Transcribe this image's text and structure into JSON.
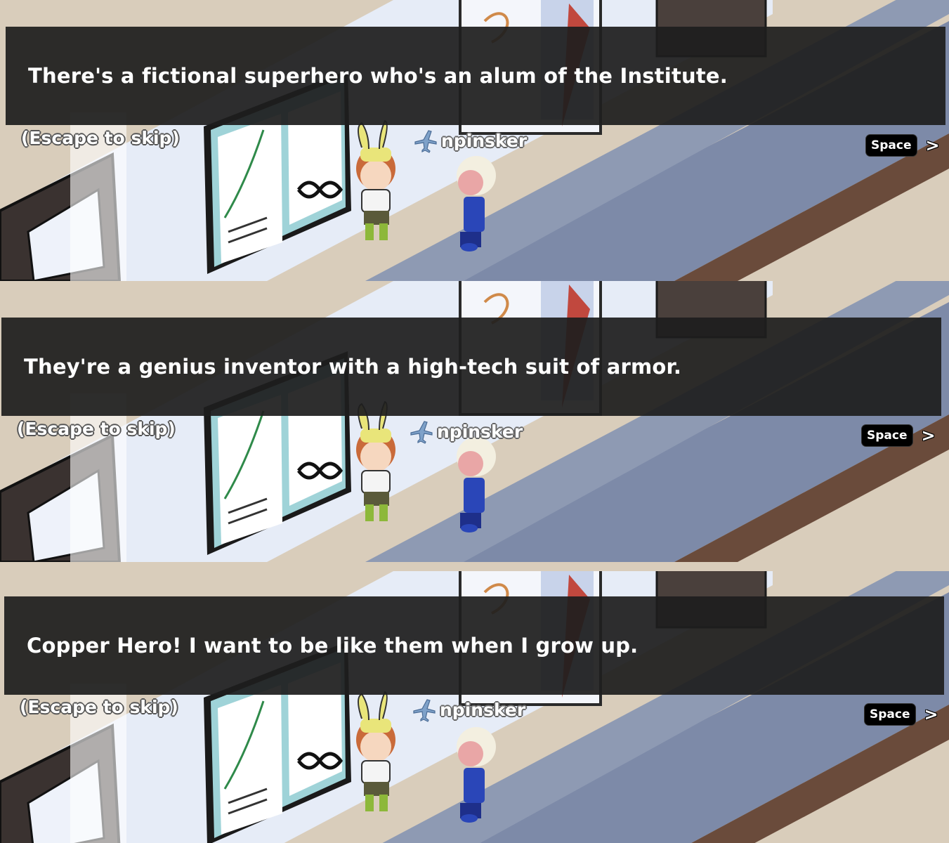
{
  "panels": [
    {
      "dialog": "There's a fictional superhero who's an alum of the Institute.",
      "skip_label": "(Escape to skip)",
      "username": "npinsker",
      "advance_key": "Space",
      "advance_arrow": ">"
    },
    {
      "dialog": "They're a genius inventor with a high-tech suit of armor.",
      "skip_label": "(Escape to skip)",
      "username": "npinsker",
      "advance_key": "Space",
      "advance_arrow": ">"
    },
    {
      "dialog": "Copper Hero! I want to be like them when I grow up.",
      "skip_label": "(Escape to skip)",
      "username": "npinsker",
      "advance_key": "Space",
      "advance_arrow": ">"
    }
  ],
  "colors": {
    "floor": "#d9cdbb",
    "wall": "#e6ecf7",
    "dark_stripe": "#7a88a6",
    "door": "#3a3230",
    "dialog_bg": "#1e1e1e"
  },
  "icons": {
    "plane": "airplane-icon",
    "arrow": "chevron-right-icon"
  }
}
